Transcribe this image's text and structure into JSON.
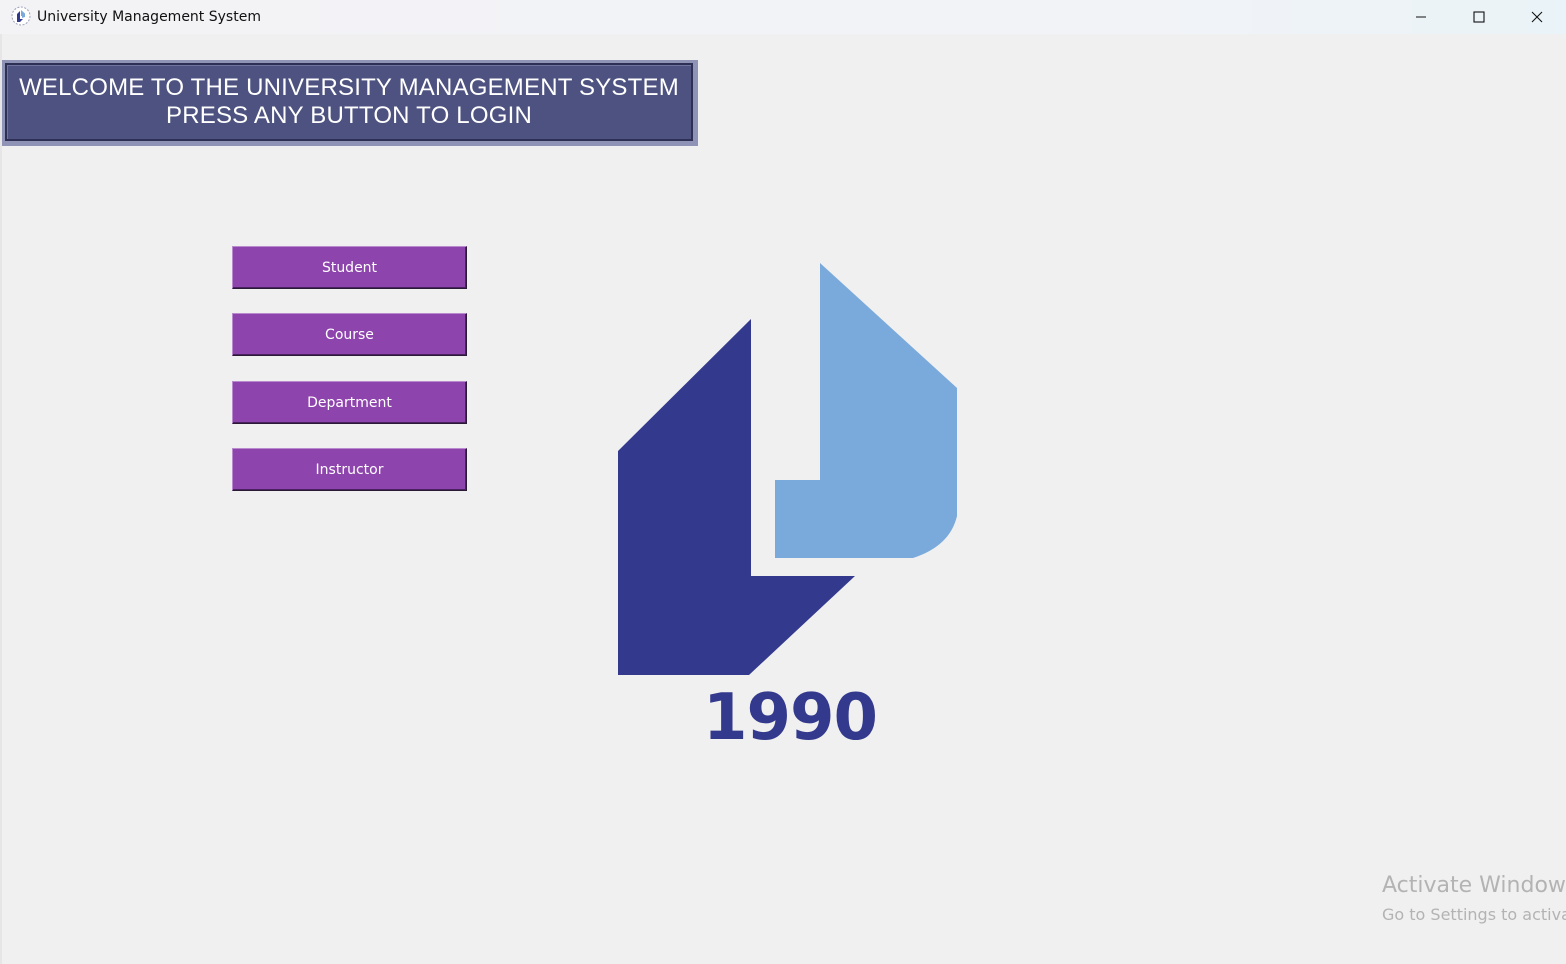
{
  "window": {
    "title": "University Management System",
    "icon": "university-logo-icon",
    "controls": {
      "minimize": "minimize-icon",
      "maximize": "maximize-icon",
      "close": "close-icon"
    }
  },
  "banner": {
    "line1": "WELCOME TO THE UNIVERSITY MANAGEMENT SYSTEM",
    "line2": "PRESS ANY BUTTON TO LOGIN"
  },
  "buttons": {
    "student": "Student",
    "course": "Course",
    "department": "Department",
    "instructor": "Instructor"
  },
  "logo": {
    "year": "1990",
    "colors": {
      "dark": "#33398c",
      "light": "#79aadb"
    }
  },
  "watermark": {
    "title": "Activate Windows",
    "subtitle": "Go to Settings to activate Windows."
  },
  "colors": {
    "button": "#8e44ad",
    "banner": "#4d5280",
    "background": "#f0f0f0"
  }
}
